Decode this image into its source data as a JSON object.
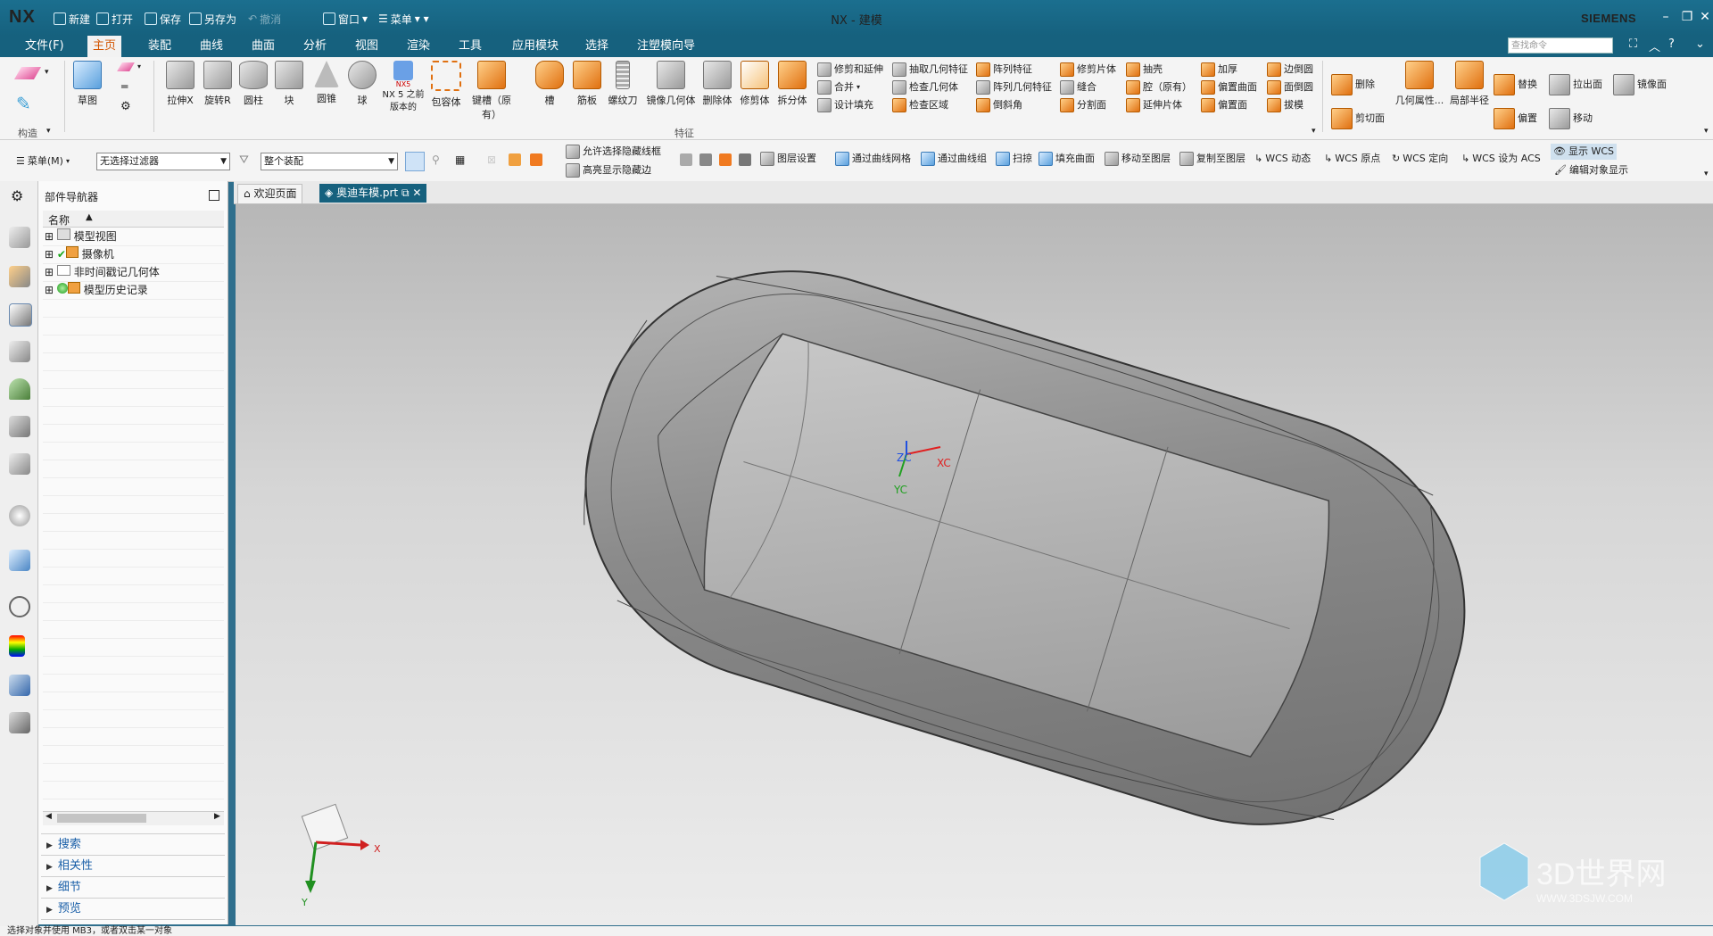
{
  "app": {
    "logo": "NX",
    "title": "NX - 建模",
    "brand": "SIEMENS"
  },
  "quick_access": {
    "new": "新建",
    "open": "打开",
    "save": "保存",
    "save_as": "另存为",
    "undo": "撤消",
    "window": "窗口",
    "menu": "菜单"
  },
  "menu_tabs": [
    "文件(F)",
    "主页",
    "装配",
    "曲线",
    "曲面",
    "分析",
    "视图",
    "渲染",
    "工具",
    "应用模块",
    "选择",
    "注塑模向导"
  ],
  "search_command": {
    "placeholder": "查找命令"
  },
  "ribbon": {
    "construct": {
      "sketch": "草图",
      "label": "构造"
    },
    "feature_big": [
      "拉伸X",
      "旋转R",
      "圆柱",
      "块",
      "圆锥",
      "球",
      "NX 5 之前版本的",
      "包容体",
      "键槽（原有）",
      "槽",
      "筋板",
      "螺纹刀",
      "镜像几何体",
      "删除体",
      "修剪体",
      "拆分体"
    ],
    "feature_small": {
      "col1": [
        "修剪和延伸",
        "合并",
        "设计填充"
      ],
      "col2": [
        "抽取几何特征",
        "检查几何体",
        "检查区域"
      ],
      "col3": [
        "阵列特征",
        "阵列几何特征",
        "倒斜角"
      ],
      "col4": [
        "修剪片体",
        "缝合",
        "分割面"
      ],
      "col5": [
        "抽壳",
        "腔（原有）",
        "延伸片体"
      ],
      "col6": [
        "加厚",
        "偏置曲面",
        "偏置面"
      ],
      "col7": [
        "边倒圆",
        "面倒圆",
        "拔模"
      ]
    },
    "feature_label": "特征",
    "sync": {
      "delete": "删除",
      "cut_face": "剪切面",
      "geom_props": "几何属性...",
      "local_radius": "局部半径",
      "replace": "替换",
      "offset": "偏置",
      "pull_face": "拉出面",
      "move": "移动",
      "mirror_face": "镜像面"
    },
    "nx5_badge": "NX5"
  },
  "toolbar2": {
    "menu": "菜单(M)",
    "filter": "无选择过滤器",
    "scope": "整个装配",
    "allow_hidden": "允许选择隐藏线框",
    "highlight_hidden": "高亮显示隐藏边",
    "items": [
      "图层设置",
      "通过曲线网格",
      "通过曲线组",
      "扫掠",
      "填充曲面",
      "移动至图层",
      "复制至图层",
      "WCS 动态",
      "WCS 原点",
      "WCS 定向",
      "WCS 设为 ACS"
    ],
    "show_wcs": "显示 WCS",
    "edit_display": "编辑对象显示"
  },
  "navigator": {
    "title": "部件导航器",
    "column": "名称",
    "rows": [
      "模型视图",
      "摄像机",
      "非时间戳记几何体",
      "模型历史记录"
    ],
    "sections": [
      "搜索",
      "相关性",
      "细节",
      "预览"
    ]
  },
  "doc_tabs": {
    "welcome": "欢迎页面",
    "part": "奥迪车模.prt"
  },
  "viewport": {
    "wcs": {
      "zc": "ZC",
      "xc": "XC",
      "yc": "YC"
    },
    "triad": {
      "x": "X",
      "y": "Y"
    },
    "watermark": "3D世界网",
    "watermark_url": "WWW.3DSJW.COM"
  },
  "status": "选择对象并使用 MB3，或者双击某一对象",
  "colors": {
    "titlebar": "#16617e",
    "active_tab_text": "#d35400",
    "link_blue": "#1a5fa8"
  }
}
